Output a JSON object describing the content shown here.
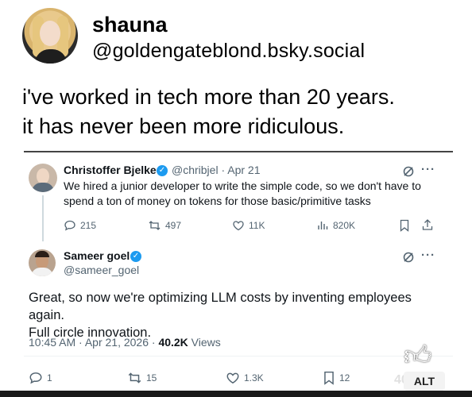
{
  "post": {
    "display_name": "shauna",
    "handle": "@goldengateblond.bsky.social",
    "text_line1": "i've worked in tech more than 20 years.",
    "text_line2": "it has never been more ridiculous."
  },
  "quoted": {
    "tweet1": {
      "name": "Christoffer Bjelke",
      "handle_date": "@chribjel · Apr 21",
      "text_line1": "We hired a junior developer to write the simple code, so we don't have to",
      "text_line2": "spend a ton of money on tokens for those basic/primitive tasks",
      "replies": "215",
      "reposts": "497",
      "likes": "11K",
      "views": "820K"
    },
    "tweet2": {
      "name": "Sameer goel",
      "handle": "@sameer_goel",
      "text_line1": "Great, so now we're optimizing LLM costs by inventing employees again.",
      "text_line2": "Full circle innovation.",
      "time": "10:45 AM · Apr 21, 2026 · ",
      "views_count": "40.2K",
      "views_label": " Views",
      "replies": "1",
      "reposts": "15",
      "likes": "1.3K",
      "bookmarks": "12"
    }
  },
  "overlay": {
    "alt_label": "ALT",
    "alt_behind": "40"
  },
  "icons": {
    "verified": "verified-badge-icon",
    "grok": "grok-icon",
    "more": "more-icon",
    "reply": "reply-icon",
    "repost": "repost-icon",
    "like": "like-icon",
    "views": "views-icon",
    "bookmark": "bookmark-icon",
    "share": "share-icon",
    "thumb": "thumbs-up-icon"
  },
  "colors": {
    "twitter_blue": "#1d9bf0",
    "secondary_text": "#536471"
  }
}
